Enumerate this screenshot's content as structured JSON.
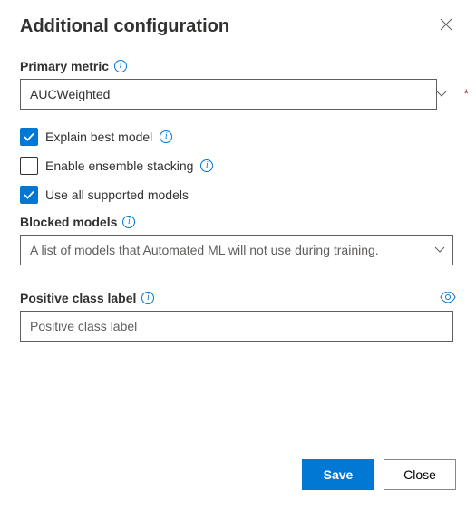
{
  "header": {
    "title": "Additional configuration"
  },
  "primaryMetric": {
    "label": "Primary metric",
    "value": "AUCWeighted"
  },
  "checkboxes": {
    "explainBestModel": {
      "label": "Explain best model",
      "checked": true
    },
    "enableEnsembleStacking": {
      "label": "Enable ensemble stacking",
      "checked": false
    },
    "useAllSupportedModels": {
      "label": "Use all supported models",
      "checked": true
    }
  },
  "blockedModels": {
    "label": "Blocked models",
    "placeholder": "A list of models that Automated ML will not use during training."
  },
  "positiveClass": {
    "label": "Positive class label",
    "placeholder": "Positive class label"
  },
  "footer": {
    "save": "Save",
    "close": "Close"
  }
}
